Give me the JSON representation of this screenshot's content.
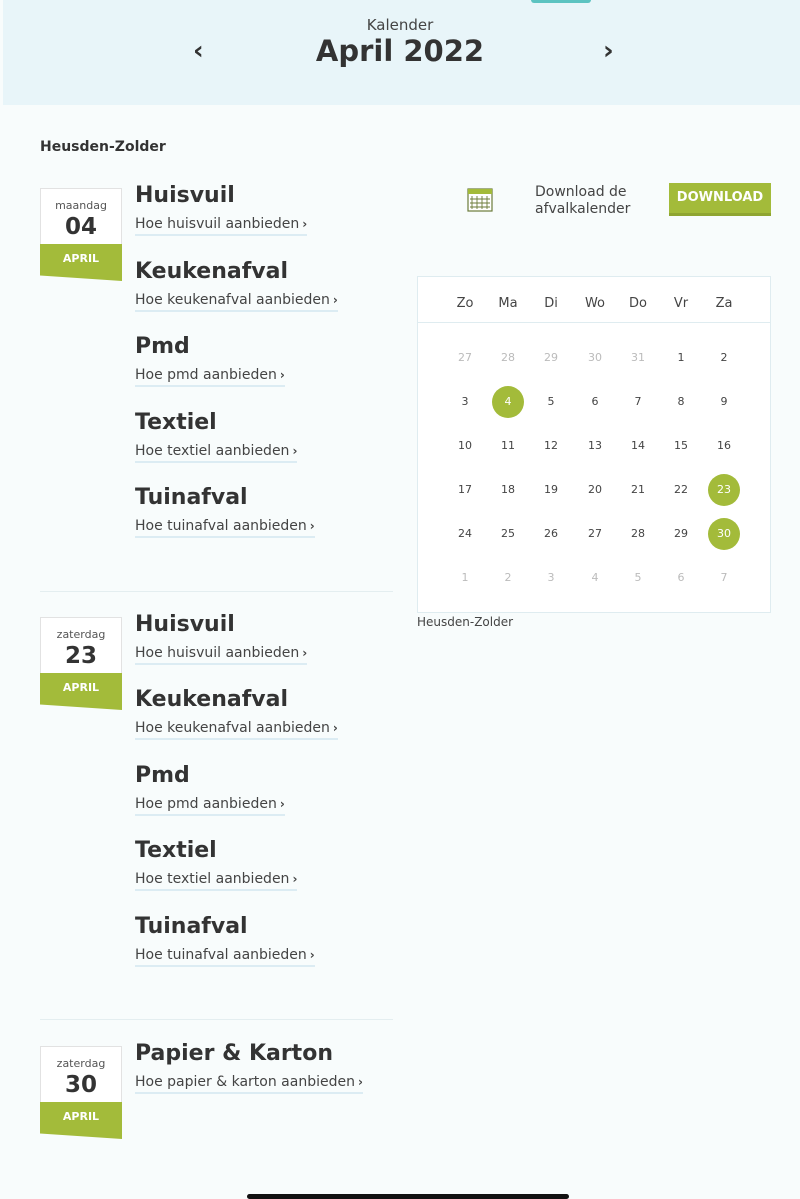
{
  "header": {
    "subtitle": "Kalender",
    "title": "April 2022",
    "prev_label": "‹",
    "next_label": "›"
  },
  "location": "Heusden-Zolder",
  "download": {
    "text_line1": "Download de",
    "text_line2": "afvalkalender",
    "button_label": "DOWNLOAD"
  },
  "schedule": [
    {
      "weekday": "maandag",
      "day": "04",
      "month": "APRIL",
      "items": [
        {
          "name": "Huisvuil",
          "link": "Hoe huisvuil aanbieden"
        },
        {
          "name": "Keukenafval",
          "link": "Hoe keukenafval aanbieden"
        },
        {
          "name": "Pmd",
          "link": "Hoe pmd aanbieden"
        },
        {
          "name": "Textiel",
          "link": "Hoe textiel aanbieden"
        },
        {
          "name": "Tuinafval",
          "link": "Hoe tuinafval aanbieden"
        }
      ]
    },
    {
      "weekday": "zaterdag",
      "day": "23",
      "month": "APRIL",
      "items": [
        {
          "name": "Huisvuil",
          "link": "Hoe huisvuil aanbieden"
        },
        {
          "name": "Keukenafval",
          "link": "Hoe keukenafval aanbieden"
        },
        {
          "name": "Pmd",
          "link": "Hoe pmd aanbieden"
        },
        {
          "name": "Textiel",
          "link": "Hoe textiel aanbieden"
        },
        {
          "name": "Tuinafval",
          "link": "Hoe tuinafval aanbieden"
        }
      ]
    },
    {
      "weekday": "zaterdag",
      "day": "30",
      "month": "APRIL",
      "items": [
        {
          "name": "Papier & Karton",
          "link": "Hoe papier & karton aanbieden"
        }
      ]
    }
  ],
  "link_chevron": "›",
  "mini_calendar": {
    "weekdays": [
      "Zo",
      "Ma",
      "Di",
      "Wo",
      "Do",
      "Vr",
      "Za"
    ],
    "weeks": [
      [
        "27",
        "28",
        "29",
        "30",
        "31",
        "1",
        "2"
      ],
      [
        "3",
        "4",
        "5",
        "6",
        "7",
        "8",
        "9"
      ],
      [
        "10",
        "11",
        "12",
        "13",
        "14",
        "15",
        "16"
      ],
      [
        "17",
        "18",
        "19",
        "20",
        "21",
        "22",
        "23"
      ],
      [
        "24",
        "25",
        "26",
        "27",
        "28",
        "29",
        "30"
      ],
      [
        "1",
        "2",
        "3",
        "4",
        "5",
        "6",
        "7"
      ]
    ],
    "muted": [
      [
        0,
        0
      ],
      [
        0,
        1
      ],
      [
        0,
        2
      ],
      [
        0,
        3
      ],
      [
        0,
        4
      ],
      [
        5,
        0
      ],
      [
        5,
        1
      ],
      [
        5,
        2
      ],
      [
        5,
        3
      ],
      [
        5,
        4
      ],
      [
        5,
        5
      ],
      [
        5,
        6
      ]
    ],
    "highlighted": [
      [
        1,
        1
      ],
      [
        3,
        6
      ],
      [
        4,
        6
      ]
    ],
    "caption": "Heusden-Zolder"
  },
  "colors": {
    "accent_green": "#a3bb3a",
    "header_bg": "#e8f5f9"
  }
}
